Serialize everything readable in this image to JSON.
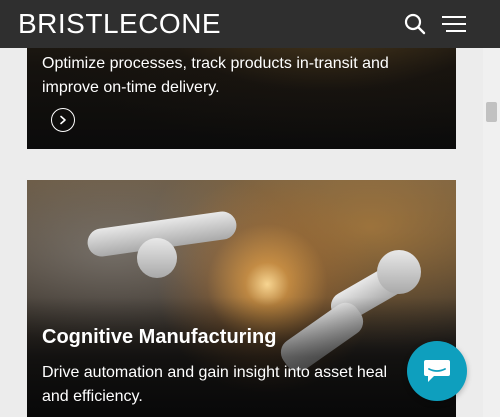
{
  "header": {
    "logo": "BRISTLECONE",
    "icons": [
      "search-icon",
      "hamburger-menu-icon"
    ],
    "background": "#2f2f2f"
  },
  "cards": [
    {
      "title": "",
      "description_lines": [
        "Optimize processes, track products in-transit and",
        "improve on-time delivery."
      ],
      "action_icon": "chevron-right-icon"
    },
    {
      "title": "Cognitive Manufacturing",
      "description_lines": [
        "Drive automation and gain insight into asset heal",
        "and efficiency."
      ]
    }
  ],
  "chat": {
    "icon": "chat-bubble-icon",
    "color": "#0e9fbe"
  }
}
